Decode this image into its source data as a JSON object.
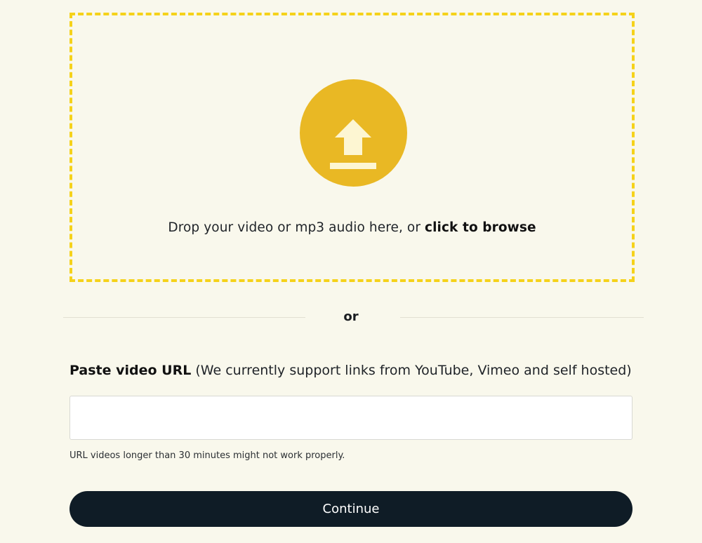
{
  "dropzone": {
    "icon": "upload-icon",
    "text_prefix": "Drop your video or mp3 audio here, or ",
    "browse_link": "click to browse",
    "border_color": "#f5d21a",
    "icon_bg_color": "#e9b824"
  },
  "divider": {
    "label": "or"
  },
  "url_section": {
    "label_bold": "Paste video URL",
    "label_rest": " (We currently support links from YouTube, Vimeo and self hosted)",
    "input_value": "",
    "input_placeholder": "",
    "note": "URL videos longer than 30 minutes might not work properly."
  },
  "continue_button": {
    "label": "Continue",
    "color": "#0f1c26"
  },
  "colors": {
    "background": "#f9f8ec"
  }
}
